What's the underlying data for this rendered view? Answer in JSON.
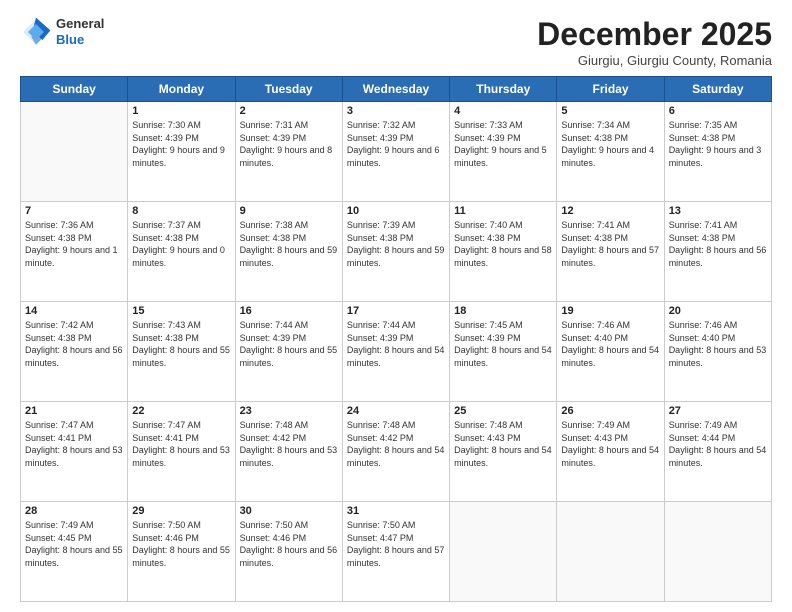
{
  "header": {
    "logo": {
      "general": "General",
      "blue": "Blue"
    },
    "title": "December 2025",
    "location": "Giurgiu, Giurgiu County, Romania"
  },
  "weekdays": [
    "Sunday",
    "Monday",
    "Tuesday",
    "Wednesday",
    "Thursday",
    "Friday",
    "Saturday"
  ],
  "weeks": [
    [
      {
        "day": "",
        "sunrise": "",
        "sunset": "",
        "daylight": ""
      },
      {
        "day": "1",
        "sunrise": "Sunrise: 7:30 AM",
        "sunset": "Sunset: 4:39 PM",
        "daylight": "Daylight: 9 hours and 9 minutes."
      },
      {
        "day": "2",
        "sunrise": "Sunrise: 7:31 AM",
        "sunset": "Sunset: 4:39 PM",
        "daylight": "Daylight: 9 hours and 8 minutes."
      },
      {
        "day": "3",
        "sunrise": "Sunrise: 7:32 AM",
        "sunset": "Sunset: 4:39 PM",
        "daylight": "Daylight: 9 hours and 6 minutes."
      },
      {
        "day": "4",
        "sunrise": "Sunrise: 7:33 AM",
        "sunset": "Sunset: 4:39 PM",
        "daylight": "Daylight: 9 hours and 5 minutes."
      },
      {
        "day": "5",
        "sunrise": "Sunrise: 7:34 AM",
        "sunset": "Sunset: 4:38 PM",
        "daylight": "Daylight: 9 hours and 4 minutes."
      },
      {
        "day": "6",
        "sunrise": "Sunrise: 7:35 AM",
        "sunset": "Sunset: 4:38 PM",
        "daylight": "Daylight: 9 hours and 3 minutes."
      }
    ],
    [
      {
        "day": "7",
        "sunrise": "Sunrise: 7:36 AM",
        "sunset": "Sunset: 4:38 PM",
        "daylight": "Daylight: 9 hours and 1 minute."
      },
      {
        "day": "8",
        "sunrise": "Sunrise: 7:37 AM",
        "sunset": "Sunset: 4:38 PM",
        "daylight": "Daylight: 9 hours and 0 minutes."
      },
      {
        "day": "9",
        "sunrise": "Sunrise: 7:38 AM",
        "sunset": "Sunset: 4:38 PM",
        "daylight": "Daylight: 8 hours and 59 minutes."
      },
      {
        "day": "10",
        "sunrise": "Sunrise: 7:39 AM",
        "sunset": "Sunset: 4:38 PM",
        "daylight": "Daylight: 8 hours and 59 minutes."
      },
      {
        "day": "11",
        "sunrise": "Sunrise: 7:40 AM",
        "sunset": "Sunset: 4:38 PM",
        "daylight": "Daylight: 8 hours and 58 minutes."
      },
      {
        "day": "12",
        "sunrise": "Sunrise: 7:41 AM",
        "sunset": "Sunset: 4:38 PM",
        "daylight": "Daylight: 8 hours and 57 minutes."
      },
      {
        "day": "13",
        "sunrise": "Sunrise: 7:41 AM",
        "sunset": "Sunset: 4:38 PM",
        "daylight": "Daylight: 8 hours and 56 minutes."
      }
    ],
    [
      {
        "day": "14",
        "sunrise": "Sunrise: 7:42 AM",
        "sunset": "Sunset: 4:38 PM",
        "daylight": "Daylight: 8 hours and 56 minutes."
      },
      {
        "day": "15",
        "sunrise": "Sunrise: 7:43 AM",
        "sunset": "Sunset: 4:38 PM",
        "daylight": "Daylight: 8 hours and 55 minutes."
      },
      {
        "day": "16",
        "sunrise": "Sunrise: 7:44 AM",
        "sunset": "Sunset: 4:39 PM",
        "daylight": "Daylight: 8 hours and 55 minutes."
      },
      {
        "day": "17",
        "sunrise": "Sunrise: 7:44 AM",
        "sunset": "Sunset: 4:39 PM",
        "daylight": "Daylight: 8 hours and 54 minutes."
      },
      {
        "day": "18",
        "sunrise": "Sunrise: 7:45 AM",
        "sunset": "Sunset: 4:39 PM",
        "daylight": "Daylight: 8 hours and 54 minutes."
      },
      {
        "day": "19",
        "sunrise": "Sunrise: 7:46 AM",
        "sunset": "Sunset: 4:40 PM",
        "daylight": "Daylight: 8 hours and 54 minutes."
      },
      {
        "day": "20",
        "sunrise": "Sunrise: 7:46 AM",
        "sunset": "Sunset: 4:40 PM",
        "daylight": "Daylight: 8 hours and 53 minutes."
      }
    ],
    [
      {
        "day": "21",
        "sunrise": "Sunrise: 7:47 AM",
        "sunset": "Sunset: 4:41 PM",
        "daylight": "Daylight: 8 hours and 53 minutes."
      },
      {
        "day": "22",
        "sunrise": "Sunrise: 7:47 AM",
        "sunset": "Sunset: 4:41 PM",
        "daylight": "Daylight: 8 hours and 53 minutes."
      },
      {
        "day": "23",
        "sunrise": "Sunrise: 7:48 AM",
        "sunset": "Sunset: 4:42 PM",
        "daylight": "Daylight: 8 hours and 53 minutes."
      },
      {
        "day": "24",
        "sunrise": "Sunrise: 7:48 AM",
        "sunset": "Sunset: 4:42 PM",
        "daylight": "Daylight: 8 hours and 54 minutes."
      },
      {
        "day": "25",
        "sunrise": "Sunrise: 7:48 AM",
        "sunset": "Sunset: 4:43 PM",
        "daylight": "Daylight: 8 hours and 54 minutes."
      },
      {
        "day": "26",
        "sunrise": "Sunrise: 7:49 AM",
        "sunset": "Sunset: 4:43 PM",
        "daylight": "Daylight: 8 hours and 54 minutes."
      },
      {
        "day": "27",
        "sunrise": "Sunrise: 7:49 AM",
        "sunset": "Sunset: 4:44 PM",
        "daylight": "Daylight: 8 hours and 54 minutes."
      }
    ],
    [
      {
        "day": "28",
        "sunrise": "Sunrise: 7:49 AM",
        "sunset": "Sunset: 4:45 PM",
        "daylight": "Daylight: 8 hours and 55 minutes."
      },
      {
        "day": "29",
        "sunrise": "Sunrise: 7:50 AM",
        "sunset": "Sunset: 4:46 PM",
        "daylight": "Daylight: 8 hours and 55 minutes."
      },
      {
        "day": "30",
        "sunrise": "Sunrise: 7:50 AM",
        "sunset": "Sunset: 4:46 PM",
        "daylight": "Daylight: 8 hours and 56 minutes."
      },
      {
        "day": "31",
        "sunrise": "Sunrise: 7:50 AM",
        "sunset": "Sunset: 4:47 PM",
        "daylight": "Daylight: 8 hours and 57 minutes."
      },
      {
        "day": "",
        "sunrise": "",
        "sunset": "",
        "daylight": ""
      },
      {
        "day": "",
        "sunrise": "",
        "sunset": "",
        "daylight": ""
      },
      {
        "day": "",
        "sunrise": "",
        "sunset": "",
        "daylight": ""
      }
    ]
  ]
}
